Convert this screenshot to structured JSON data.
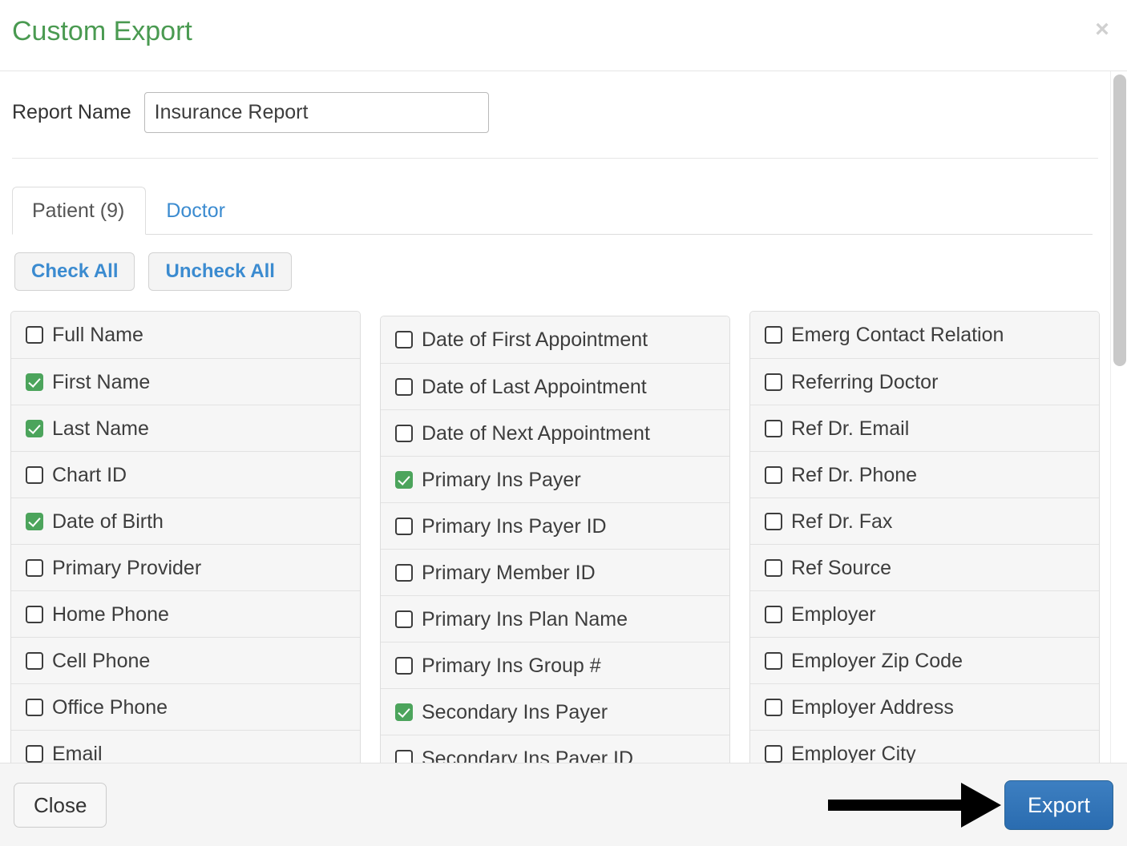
{
  "dialog": {
    "title": "Custom Export",
    "close_icon": "×"
  },
  "report_name": {
    "label": "Report Name",
    "value": "Insurance Report",
    "placeholder": "Report Name"
  },
  "tabs": [
    {
      "label": "Patient (9)",
      "active": true
    },
    {
      "label": "Doctor",
      "active": false
    }
  ],
  "actions": {
    "check_all": "Check All",
    "uncheck_all": "Uncheck All"
  },
  "columns": [
    {
      "items": [
        {
          "label": "Full Name",
          "checked": false
        },
        {
          "label": "First Name",
          "checked": true
        },
        {
          "label": "Last Name",
          "checked": true
        },
        {
          "label": "Chart ID",
          "checked": false
        },
        {
          "label": "Date of Birth",
          "checked": true
        },
        {
          "label": "Primary Provider",
          "checked": false
        },
        {
          "label": "Home Phone",
          "checked": false
        },
        {
          "label": "Cell Phone",
          "checked": false
        },
        {
          "label": "Office Phone",
          "checked": false
        },
        {
          "label": "Email",
          "checked": false
        }
      ]
    },
    {
      "items": [
        {
          "label": "Date of First Appointment",
          "checked": false
        },
        {
          "label": "Date of Last Appointment",
          "checked": false
        },
        {
          "label": "Date of Next Appointment",
          "checked": false
        },
        {
          "label": "Primary Ins Payer",
          "checked": true
        },
        {
          "label": "Primary Ins Payer ID",
          "checked": false
        },
        {
          "label": "Primary Member ID",
          "checked": false
        },
        {
          "label": "Primary Ins Plan Name",
          "checked": false
        },
        {
          "label": "Primary Ins Group #",
          "checked": false
        },
        {
          "label": "Secondary Ins Payer",
          "checked": true
        },
        {
          "label": "Secondary Ins Payer ID",
          "checked": false
        }
      ]
    },
    {
      "items": [
        {
          "label": "Emerg Contact Relation",
          "checked": false
        },
        {
          "label": "Referring Doctor",
          "checked": false
        },
        {
          "label": "Ref Dr. Email",
          "checked": false
        },
        {
          "label": "Ref Dr. Phone",
          "checked": false
        },
        {
          "label": "Ref Dr. Fax",
          "checked": false
        },
        {
          "label": "Ref Source",
          "checked": false
        },
        {
          "label": "Employer",
          "checked": false
        },
        {
          "label": "Employer Zip Code",
          "checked": false
        },
        {
          "label": "Employer Address",
          "checked": false
        },
        {
          "label": "Employer City",
          "checked": false
        }
      ]
    }
  ],
  "footer": {
    "close": "Close",
    "export": "Export"
  },
  "colors": {
    "title_green": "#4a9a51",
    "checkbox_green": "#4ca45c",
    "link_blue": "#3b8bd0",
    "export_blue": "#2f72b8"
  }
}
